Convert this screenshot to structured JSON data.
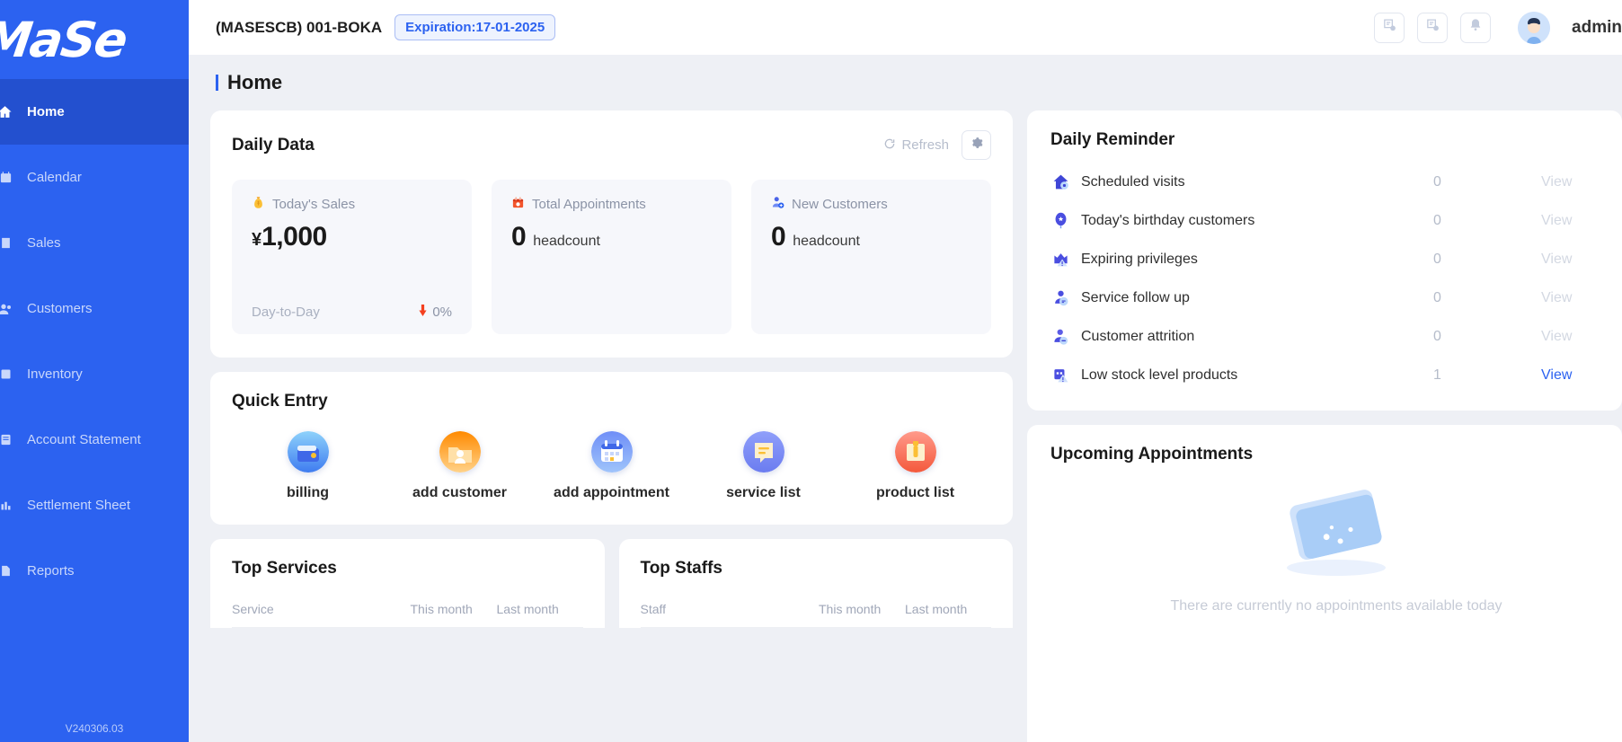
{
  "sidebar": {
    "logo": "MaSe",
    "version": "V240306.03",
    "items": [
      {
        "label": "Home",
        "icon": "home-icon",
        "active": true
      },
      {
        "label": "Calendar",
        "icon": "calendar-icon",
        "active": false
      },
      {
        "label": "Sales",
        "icon": "sales-icon",
        "active": false
      },
      {
        "label": "Customers",
        "icon": "customers-icon",
        "active": false
      },
      {
        "label": "Inventory",
        "icon": "inventory-icon",
        "active": false
      },
      {
        "label": "Account Statement",
        "icon": "account-statement-icon",
        "active": false
      },
      {
        "label": "Settlement Sheet",
        "icon": "settlement-sheet-icon",
        "active": false
      },
      {
        "label": "Reports",
        "icon": "reports-icon",
        "active": false
      }
    ]
  },
  "topbar": {
    "store": "(MASESCB) 001-BOKA",
    "expiration": "Expiration:17-01-2025",
    "icons": [
      "document-clock-icon",
      "document-clock-icon",
      "bell-icon"
    ],
    "user": "admin"
  },
  "page": {
    "title": "Home"
  },
  "daily_data": {
    "title": "Daily Data",
    "refresh_label": "Refresh",
    "refresh_icon": "refresh-icon",
    "settings_icon": "gear-icon",
    "stats": [
      {
        "label": "Today's Sales",
        "icon": "money-bag-icon",
        "currency": "¥",
        "value": "1,000",
        "unit": "",
        "foot_label": "Day-to-Day",
        "foot_delta": "0%",
        "foot_icon": "arrow-down-icon"
      },
      {
        "label": "Total Appointments",
        "icon": "appointment-icon",
        "currency": "",
        "value": "0",
        "unit": "headcount",
        "foot_label": "",
        "foot_delta": "",
        "foot_icon": ""
      },
      {
        "label": "New Customers",
        "icon": "new-customer-icon",
        "currency": "",
        "value": "0",
        "unit": "headcount",
        "foot_label": "",
        "foot_delta": "",
        "foot_icon": ""
      }
    ]
  },
  "quick_entry": {
    "title": "Quick Entry",
    "items": [
      {
        "label": "billing",
        "icon": "wallet-icon"
      },
      {
        "label": "add customer",
        "icon": "add-customer-icon"
      },
      {
        "label": "add appointment",
        "icon": "calendar-add-icon"
      },
      {
        "label": "service list",
        "icon": "service-list-icon"
      },
      {
        "label": "product list",
        "icon": "product-list-icon"
      }
    ]
  },
  "top_services": {
    "title": "Top Services",
    "columns": [
      "Service",
      "This month",
      "Last month"
    ]
  },
  "top_staffs": {
    "title": "Top Staffs",
    "columns": [
      "Staff",
      "This month",
      "Last month"
    ]
  },
  "daily_reminder": {
    "title": "Daily Reminder",
    "rows": [
      {
        "label": "Scheduled visits",
        "icon": "scheduled-visit-icon",
        "count": "0",
        "view": "View",
        "active": false
      },
      {
        "label": "Today's birthday customers",
        "icon": "birthday-balloon-icon",
        "count": "0",
        "view": "View",
        "active": false
      },
      {
        "label": "Expiring privileges",
        "icon": "expiring-privilege-icon",
        "count": "0",
        "view": "View",
        "active": false
      },
      {
        "label": "Service follow up",
        "icon": "service-followup-icon",
        "count": "0",
        "view": "View",
        "active": false
      },
      {
        "label": "Customer attrition",
        "icon": "customer-attrition-icon",
        "count": "0",
        "view": "View",
        "active": false
      },
      {
        "label": "Low stock level products",
        "icon": "low-stock-icon",
        "count": "1",
        "view": "View",
        "active": true
      }
    ]
  },
  "upcoming": {
    "title": "Upcoming Appointments",
    "empty_text": "There are currently no appointments available today",
    "empty_icon": "empty-cards-icon"
  },
  "colors": {
    "sidebar": "#2c62f0",
    "sidebar_active": "#2350cf",
    "accent": "#2c62f0",
    "page_bg": "#eef0f5",
    "card_bg": "#ffffff",
    "down_arrow": "#f4401f"
  }
}
